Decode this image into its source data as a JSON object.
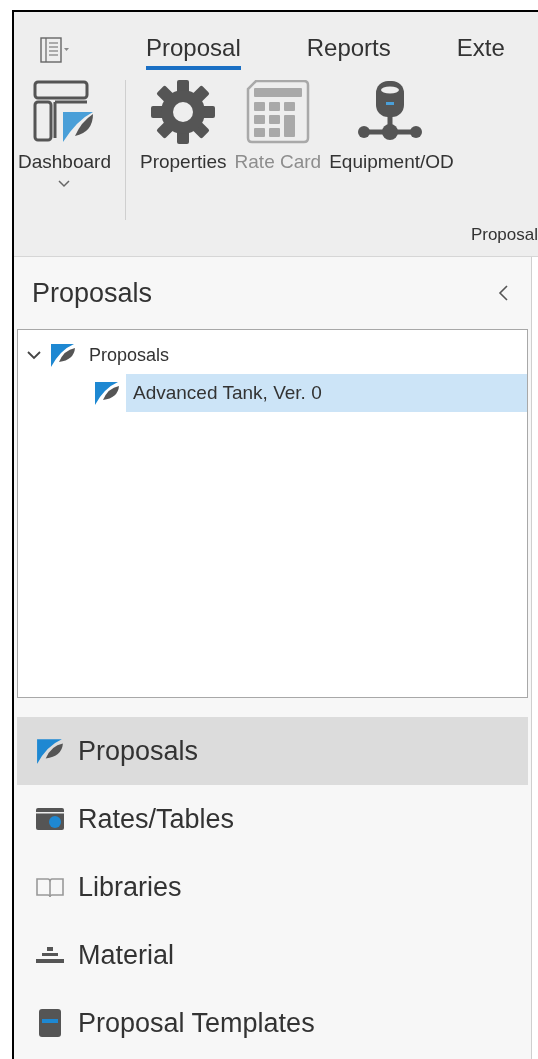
{
  "ribbon": {
    "tabs": [
      {
        "label": "Proposal",
        "selected": true
      },
      {
        "label": "Reports",
        "selected": false
      },
      {
        "label": "Exte",
        "selected": false
      }
    ],
    "buttons": [
      {
        "kind": "dashboard",
        "label": "Dashboard",
        "disabled": false,
        "dropdown": true
      },
      {
        "kind": "gear",
        "label": "Properties",
        "disabled": false,
        "dropdown": false
      },
      {
        "kind": "calculator",
        "label": "Rate Card",
        "disabled": true,
        "dropdown": false
      },
      {
        "kind": "network",
        "label": "Equipment/OD",
        "disabled": false,
        "dropdown": false
      }
    ],
    "group_label": "Proposal"
  },
  "panel": {
    "title": "Proposals",
    "tree": [
      {
        "label": "Proposals",
        "expanded": true,
        "selected": false,
        "children": [
          {
            "label": "Advanced Tank, Ver. 0",
            "selected": true
          }
        ]
      }
    ],
    "nav_items": [
      {
        "kind": "proposal",
        "label": "Proposals",
        "selected": true
      },
      {
        "kind": "rates",
        "label": "Rates/Tables",
        "selected": false
      },
      {
        "kind": "book",
        "label": "Libraries",
        "selected": false
      },
      {
        "kind": "material",
        "label": "Material",
        "selected": false
      },
      {
        "kind": "template",
        "label": "Proposal Templates",
        "selected": false
      }
    ]
  }
}
